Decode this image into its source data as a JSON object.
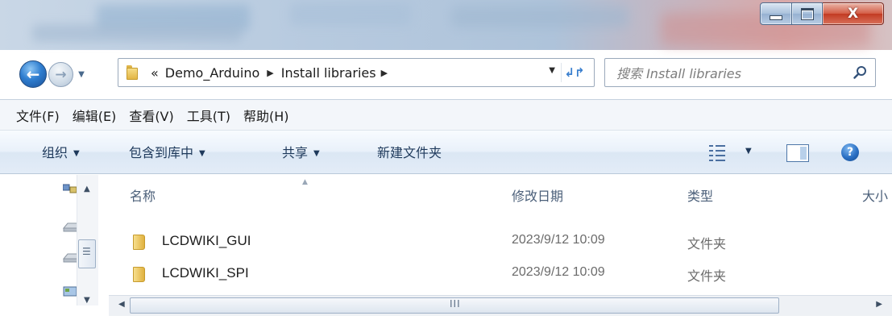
{
  "window": {
    "caption_buttons": {
      "minimize_icon": "minimize-glyph",
      "maximize_icon": "maximize-glyph",
      "close_label": "X"
    }
  },
  "address_bar": {
    "overflow": "«",
    "crumbs": [
      "Demo_Arduino",
      "Install libraries"
    ],
    "separator_icon": "chevron-right",
    "dropdown_icon": "chevron-down",
    "refresh_icon": "refresh-arrows"
  },
  "search": {
    "placeholder": "搜索 Install libraries",
    "icon": "magnifier-icon"
  },
  "menu": [
    "文件(F)",
    "编辑(E)",
    "查看(V)",
    "工具(T)",
    "帮助(H)"
  ],
  "command_bar": {
    "organize": "组织",
    "include_in_library": "包含到库中",
    "share": "共享",
    "new_folder": "新建文件夹",
    "help_label": "?"
  },
  "columns": {
    "name": "名称",
    "date": "修改日期",
    "type": "类型",
    "size": "大小"
  },
  "files": [
    {
      "name": "LCDWIKI_GUI",
      "date": "2023/9/12 10:09",
      "type": "文件夹"
    },
    {
      "name": "LCDWIKI_SPI",
      "date": "2023/9/12 10:09",
      "type": "文件夹"
    }
  ],
  "hscroll": {
    "thumb_grip": "III"
  },
  "colors": {
    "accent": "#1e395b",
    "folder": "#e2b546",
    "close": "#c23a22"
  }
}
